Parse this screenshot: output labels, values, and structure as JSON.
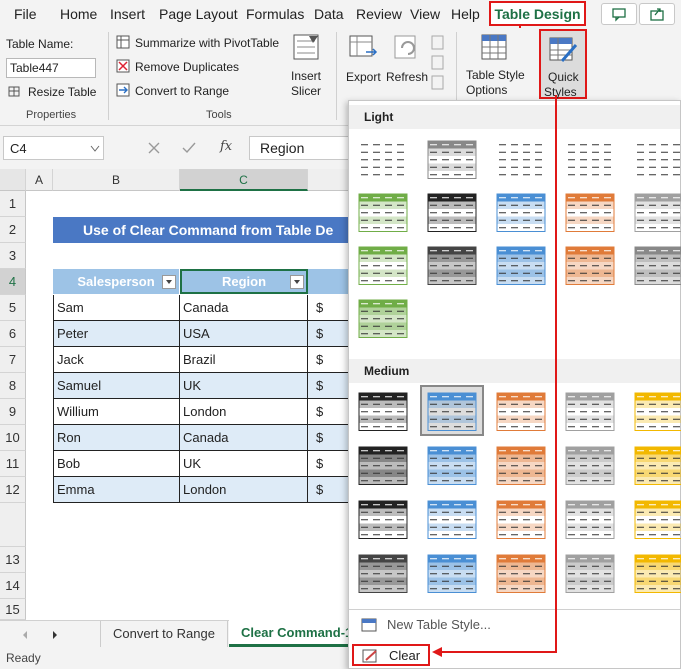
{
  "menu": {
    "items": [
      "File",
      "Home",
      "Insert",
      "Page Layout",
      "Formulas",
      "Data",
      "Review",
      "View",
      "Help"
    ],
    "active_tab": "Table Design"
  },
  "ribbon": {
    "properties": {
      "table_name_label": "Table Name:",
      "table_name_value": "Table447",
      "resize_label": "Resize Table",
      "group_label": "Properties"
    },
    "tools": {
      "summarize_label": "Summarize with PivotTable",
      "remove_dup_label": "Remove Duplicates",
      "convert_label": "Convert to Range",
      "insert_slicer_line1": "Insert",
      "insert_slicer_line2": "Slicer",
      "group_label": "Tools"
    },
    "external": {
      "export_label": "Export",
      "refresh_label": "Refresh"
    },
    "style_options": {
      "line1": "Table Style",
      "line2": "Options"
    },
    "quick_styles": {
      "line1": "Quick",
      "line2": "Styles"
    }
  },
  "formula_bar": {
    "name_box": "C4",
    "fx_label": "fx",
    "value": "Region"
  },
  "sheet": {
    "columns": [
      "A",
      "B",
      "C"
    ],
    "rows": [
      "1",
      "2",
      "3",
      "4",
      "5",
      "6",
      "7",
      "8",
      "9",
      "10",
      "11",
      "12",
      "13",
      "14",
      "15"
    ],
    "title": "Use of Clear Command from Table De",
    "headers": [
      "Salesperson",
      "Region"
    ],
    "data": [
      {
        "name": "Sam",
        "region": "Canada",
        "d": "$"
      },
      {
        "name": "Peter",
        "region": "USA",
        "d": "$"
      },
      {
        "name": "Jack",
        "region": "Brazil",
        "d": "$"
      },
      {
        "name": "Samuel",
        "region": "UK",
        "d": "$"
      },
      {
        "name": "Willium",
        "region": "London",
        "d": "$"
      },
      {
        "name": "Ron",
        "region": "Canada",
        "d": "$"
      },
      {
        "name": "Bob",
        "region": "UK",
        "d": "$"
      },
      {
        "name": "Emma",
        "region": "London",
        "d": "$"
      }
    ]
  },
  "sheet_tabs": [
    "Convert to Range",
    "Clear Command-1"
  ],
  "status": "Ready",
  "gallery": {
    "light_label": "Light",
    "medium_label": "Medium",
    "new_style_label": "New Table Style...",
    "clear_label": "Clear"
  },
  "colors": {
    "accent_red": "#e01818",
    "excel_green": "#1e7145",
    "title_blue": "#4a78c4",
    "header_blue": "#9dc3e6",
    "band_blue": "#deebf7"
  }
}
